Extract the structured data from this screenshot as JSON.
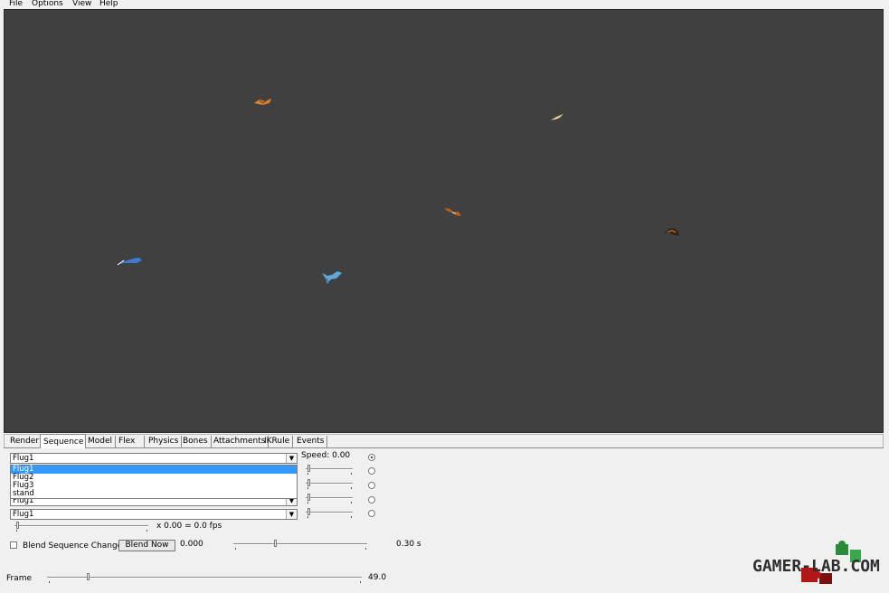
{
  "menu": {
    "file": "File",
    "options": "Options",
    "view": "View",
    "help": "Help"
  },
  "tabs": [
    "Render",
    "Sequence",
    "Model",
    "Flex",
    "Physics",
    "Bones",
    "Attachments",
    "IKRule",
    "Events"
  ],
  "sequence": {
    "select1_value": "Flug1",
    "dropdown_options": [
      "Flug1",
      "Flug2",
      "Flug3",
      "stand"
    ],
    "select4_value": "Flug1",
    "select5_value": "Flug1",
    "speed_label": "Speed: 0.00",
    "fps_text": "x 0.00 = 0.0 fps",
    "blend_checkbox_label": "Blend Sequence Changes",
    "blend_checked": false,
    "blend_now_label": "Blend Now",
    "blend_value": "0.000",
    "blend_time": "0.30 s"
  },
  "frame": {
    "label": "Frame",
    "value": "49.0"
  },
  "watermark": {
    "text": "GAMER-LAB.COM"
  },
  "colors": {
    "viewport": "#404040",
    "selection": "#3399ff",
    "panel": "#f0f0f0"
  }
}
